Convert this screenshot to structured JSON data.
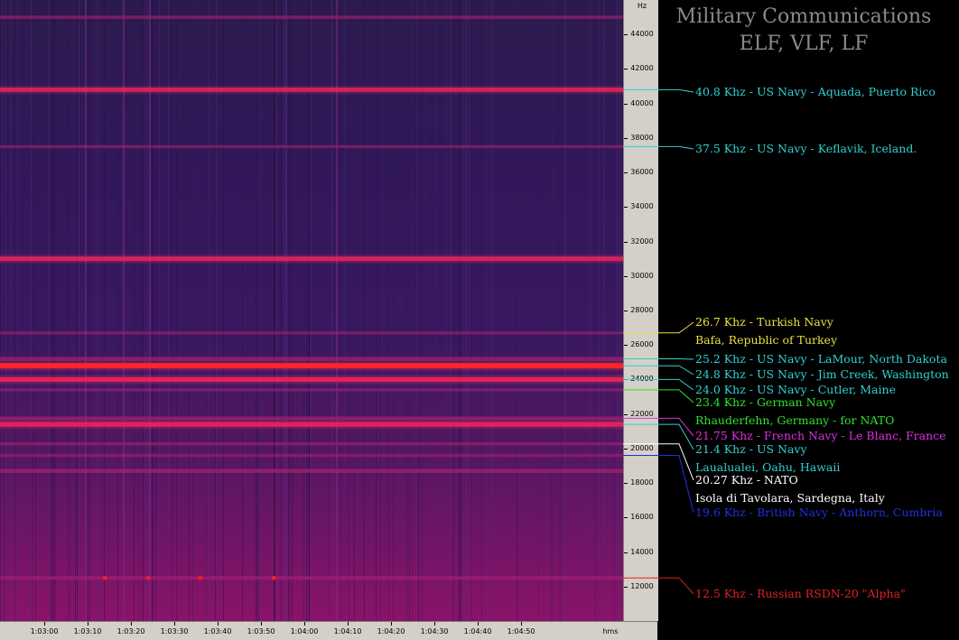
{
  "chart_data": {
    "type": "heatmap",
    "title": "Military Communications",
    "subtitle": "ELF, VLF, LF",
    "y_unit": "Hz",
    "x_unit": "hms",
    "ylim": [
      10000,
      46000
    ],
    "yticks": [
      12000,
      14000,
      16000,
      18000,
      20000,
      22000,
      24000,
      26000,
      28000,
      30000,
      32000,
      34000,
      36000,
      38000,
      40000,
      42000,
      44000
    ],
    "yticklabels": [
      "12000",
      "14000",
      "16000",
      "18000",
      "20000",
      "22000",
      "24000",
      "26000",
      "28000",
      "30000",
      "32000",
      "34000",
      "36000",
      "38000",
      "40000",
      "42000",
      "44000"
    ],
    "xticks": [
      "1:03:00",
      "1:03:10",
      "1:03:20",
      "1:03:30",
      "1:03:40",
      "1:03:50",
      "1:04:00",
      "1:04:10",
      "1:04:20",
      "1:04:30",
      "1:04:40",
      "1:04:50"
    ],
    "bands_hz": [
      {
        "freq": 40800,
        "intensity": 0.7
      },
      {
        "freq": 37500,
        "intensity": 0.3
      },
      {
        "freq": 31000,
        "intensity": 0.75
      },
      {
        "freq": 26700,
        "intensity": 0.3
      },
      {
        "freq": 25200,
        "intensity": 0.55
      },
      {
        "freq": 24800,
        "intensity": 1.0
      },
      {
        "freq": 24000,
        "intensity": 0.85
      },
      {
        "freq": 23400,
        "intensity": 0.35
      },
      {
        "freq": 21750,
        "intensity": 0.5
      },
      {
        "freq": 21400,
        "intensity": 0.85
      },
      {
        "freq": 20270,
        "intensity": 0.35
      },
      {
        "freq": 19600,
        "intensity": 0.35
      },
      {
        "freq": 18700,
        "intensity": 0.6
      },
      {
        "freq": 12500,
        "intensity": 0.5
      },
      {
        "freq": 45000,
        "intensity": 0.4
      }
    ],
    "bursts": [
      {
        "time": "1:03:14",
        "freq": 12500
      },
      {
        "time": "1:03:24",
        "freq": 12500
      },
      {
        "time": "1:03:36",
        "freq": 12500
      },
      {
        "time": "1:03:53",
        "freq": 12500
      }
    ],
    "annotations": [
      {
        "text": "40.8 Khz - US Navy - Aquada, Puerto Rico",
        "freq": 40800,
        "color": "#30d0d0"
      },
      {
        "text": "37.5 Khz - US Navy - Keflavik, Iceland.",
        "freq": 37500,
        "color": "#30d0d0"
      },
      {
        "text": "26.7 Khz - Turkish Navy",
        "freq": 26700,
        "color": "#e8e040"
      },
      {
        "text": "Bafa, Republic of Turkey",
        "freq": 26700,
        "color": "#e8e040"
      },
      {
        "text": "25.2 Khz - US Navy - LaMour, North Dakota",
        "freq": 25200,
        "color": "#30d0d0"
      },
      {
        "text": "24.8 Khz - US Navy - Jim Creek, Washington",
        "freq": 24800,
        "color": "#30d0d0"
      },
      {
        "text": "24.0 Khz - US Navy - Cutler, Maine",
        "freq": 24000,
        "color": "#30d0d0"
      },
      {
        "text": "23.4 Khz - German Navy",
        "freq": 23400,
        "color": "#30e030"
      },
      {
        "text": "Rhauderfehn, Germany - for NATO",
        "freq": 23400,
        "color": "#30e030"
      },
      {
        "text": "21.75 Khz - French Navy - Le Blanc, France",
        "freq": 21750,
        "color": "#e030e0"
      },
      {
        "text": "21.4 Khz - US Navy",
        "freq": 21400,
        "color": "#30d0d0"
      },
      {
        "text": "Laualualei, Oahu, Hawaii",
        "freq": 21400,
        "color": "#30d0d0"
      },
      {
        "text": "20.27 Khz - NATO",
        "freq": 20270,
        "color": "#ffffff"
      },
      {
        "text": "Isola di Tavolara, Sardegna, Italy",
        "freq": 20270,
        "color": "#ffffff"
      },
      {
        "text": "19.6 Khz - British Navy - Anthorn, Cumbria",
        "freq": 19600,
        "color": "#2030e0"
      },
      {
        "text": "12.5 Khz - Russian RSDN-20 \"Alpha\"",
        "freq": 12500,
        "color": "#e02020"
      }
    ]
  }
}
